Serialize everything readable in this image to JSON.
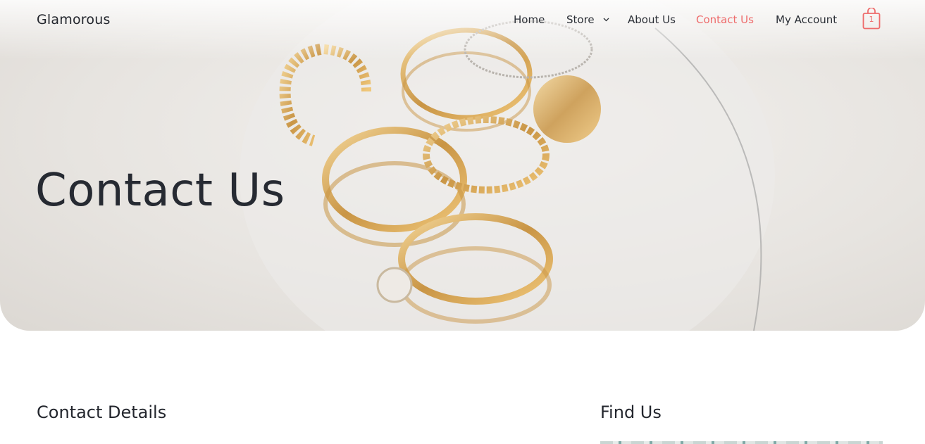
{
  "brand": {
    "name": "Glamorous"
  },
  "nav": {
    "items": [
      {
        "label": "Home",
        "active": false
      },
      {
        "label": "Store",
        "active": false,
        "has_dropdown": true
      },
      {
        "label": "About Us",
        "active": false
      },
      {
        "label": "Contact Us",
        "active": true
      },
      {
        "label": "My Account",
        "active": false
      }
    ],
    "cart": {
      "icon": "shopping-bag-icon",
      "count": "1"
    }
  },
  "hero": {
    "title": "Contact Us"
  },
  "sections": {
    "contact_details": {
      "title": "Contact Details"
    },
    "find_us": {
      "title": "Find Us"
    }
  },
  "colors": {
    "accent": "#ee6b6b",
    "text": "#23262d"
  }
}
